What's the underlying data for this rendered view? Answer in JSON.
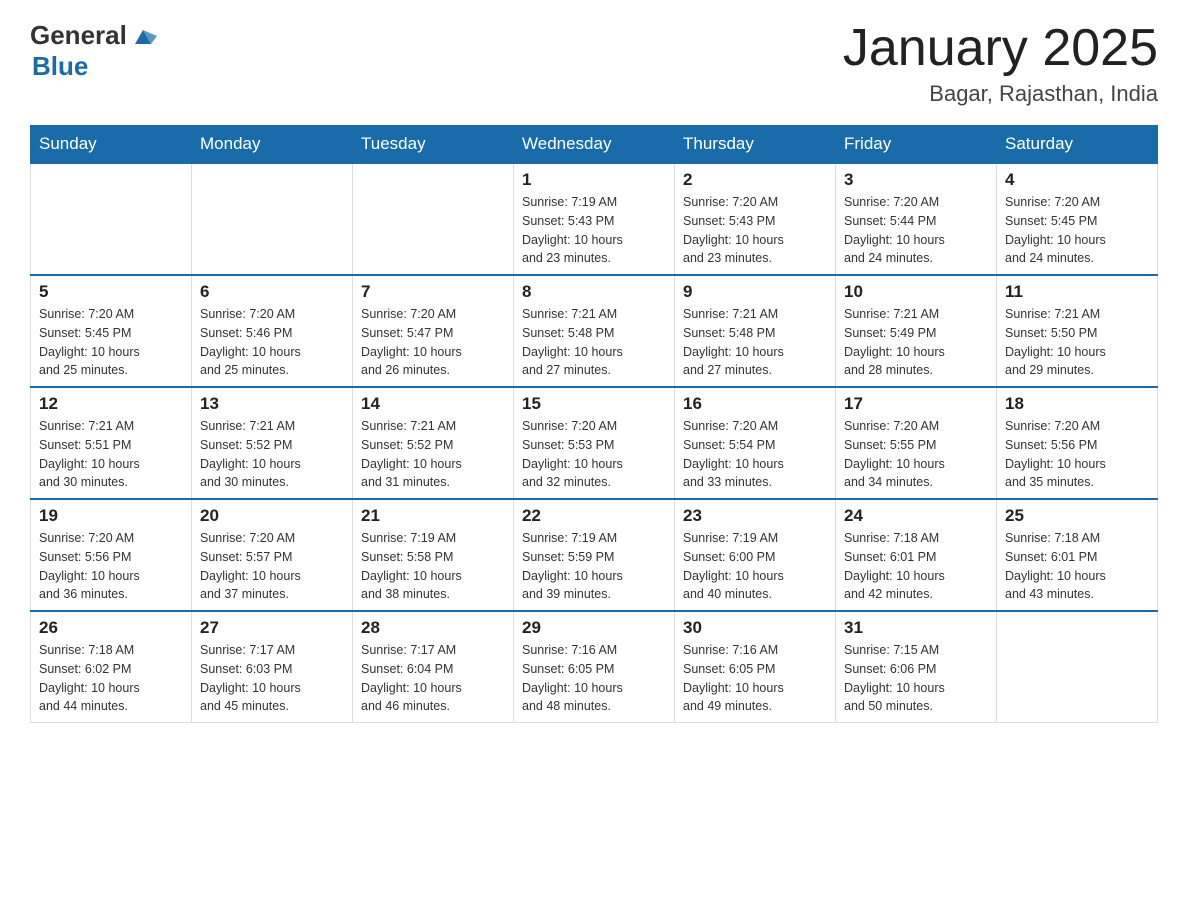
{
  "logo": {
    "general": "General",
    "blue": "Blue"
  },
  "header": {
    "title": "January 2025",
    "subtitle": "Bagar, Rajasthan, India"
  },
  "days_of_week": [
    "Sunday",
    "Monday",
    "Tuesday",
    "Wednesday",
    "Thursday",
    "Friday",
    "Saturday"
  ],
  "weeks": [
    [
      {
        "day": "",
        "info": ""
      },
      {
        "day": "",
        "info": ""
      },
      {
        "day": "",
        "info": ""
      },
      {
        "day": "1",
        "info": "Sunrise: 7:19 AM\nSunset: 5:43 PM\nDaylight: 10 hours\nand 23 minutes."
      },
      {
        "day": "2",
        "info": "Sunrise: 7:20 AM\nSunset: 5:43 PM\nDaylight: 10 hours\nand 23 minutes."
      },
      {
        "day": "3",
        "info": "Sunrise: 7:20 AM\nSunset: 5:44 PM\nDaylight: 10 hours\nand 24 minutes."
      },
      {
        "day": "4",
        "info": "Sunrise: 7:20 AM\nSunset: 5:45 PM\nDaylight: 10 hours\nand 24 minutes."
      }
    ],
    [
      {
        "day": "5",
        "info": "Sunrise: 7:20 AM\nSunset: 5:45 PM\nDaylight: 10 hours\nand 25 minutes."
      },
      {
        "day": "6",
        "info": "Sunrise: 7:20 AM\nSunset: 5:46 PM\nDaylight: 10 hours\nand 25 minutes."
      },
      {
        "day": "7",
        "info": "Sunrise: 7:20 AM\nSunset: 5:47 PM\nDaylight: 10 hours\nand 26 minutes."
      },
      {
        "day": "8",
        "info": "Sunrise: 7:21 AM\nSunset: 5:48 PM\nDaylight: 10 hours\nand 27 minutes."
      },
      {
        "day": "9",
        "info": "Sunrise: 7:21 AM\nSunset: 5:48 PM\nDaylight: 10 hours\nand 27 minutes."
      },
      {
        "day": "10",
        "info": "Sunrise: 7:21 AM\nSunset: 5:49 PM\nDaylight: 10 hours\nand 28 minutes."
      },
      {
        "day": "11",
        "info": "Sunrise: 7:21 AM\nSunset: 5:50 PM\nDaylight: 10 hours\nand 29 minutes."
      }
    ],
    [
      {
        "day": "12",
        "info": "Sunrise: 7:21 AM\nSunset: 5:51 PM\nDaylight: 10 hours\nand 30 minutes."
      },
      {
        "day": "13",
        "info": "Sunrise: 7:21 AM\nSunset: 5:52 PM\nDaylight: 10 hours\nand 30 minutes."
      },
      {
        "day": "14",
        "info": "Sunrise: 7:21 AM\nSunset: 5:52 PM\nDaylight: 10 hours\nand 31 minutes."
      },
      {
        "day": "15",
        "info": "Sunrise: 7:20 AM\nSunset: 5:53 PM\nDaylight: 10 hours\nand 32 minutes."
      },
      {
        "day": "16",
        "info": "Sunrise: 7:20 AM\nSunset: 5:54 PM\nDaylight: 10 hours\nand 33 minutes."
      },
      {
        "day": "17",
        "info": "Sunrise: 7:20 AM\nSunset: 5:55 PM\nDaylight: 10 hours\nand 34 minutes."
      },
      {
        "day": "18",
        "info": "Sunrise: 7:20 AM\nSunset: 5:56 PM\nDaylight: 10 hours\nand 35 minutes."
      }
    ],
    [
      {
        "day": "19",
        "info": "Sunrise: 7:20 AM\nSunset: 5:56 PM\nDaylight: 10 hours\nand 36 minutes."
      },
      {
        "day": "20",
        "info": "Sunrise: 7:20 AM\nSunset: 5:57 PM\nDaylight: 10 hours\nand 37 minutes."
      },
      {
        "day": "21",
        "info": "Sunrise: 7:19 AM\nSunset: 5:58 PM\nDaylight: 10 hours\nand 38 minutes."
      },
      {
        "day": "22",
        "info": "Sunrise: 7:19 AM\nSunset: 5:59 PM\nDaylight: 10 hours\nand 39 minutes."
      },
      {
        "day": "23",
        "info": "Sunrise: 7:19 AM\nSunset: 6:00 PM\nDaylight: 10 hours\nand 40 minutes."
      },
      {
        "day": "24",
        "info": "Sunrise: 7:18 AM\nSunset: 6:01 PM\nDaylight: 10 hours\nand 42 minutes."
      },
      {
        "day": "25",
        "info": "Sunrise: 7:18 AM\nSunset: 6:01 PM\nDaylight: 10 hours\nand 43 minutes."
      }
    ],
    [
      {
        "day": "26",
        "info": "Sunrise: 7:18 AM\nSunset: 6:02 PM\nDaylight: 10 hours\nand 44 minutes."
      },
      {
        "day": "27",
        "info": "Sunrise: 7:17 AM\nSunset: 6:03 PM\nDaylight: 10 hours\nand 45 minutes."
      },
      {
        "day": "28",
        "info": "Sunrise: 7:17 AM\nSunset: 6:04 PM\nDaylight: 10 hours\nand 46 minutes."
      },
      {
        "day": "29",
        "info": "Sunrise: 7:16 AM\nSunset: 6:05 PM\nDaylight: 10 hours\nand 48 minutes."
      },
      {
        "day": "30",
        "info": "Sunrise: 7:16 AM\nSunset: 6:05 PM\nDaylight: 10 hours\nand 49 minutes."
      },
      {
        "day": "31",
        "info": "Sunrise: 7:15 AM\nSunset: 6:06 PM\nDaylight: 10 hours\nand 50 minutes."
      },
      {
        "day": "",
        "info": ""
      }
    ]
  ]
}
